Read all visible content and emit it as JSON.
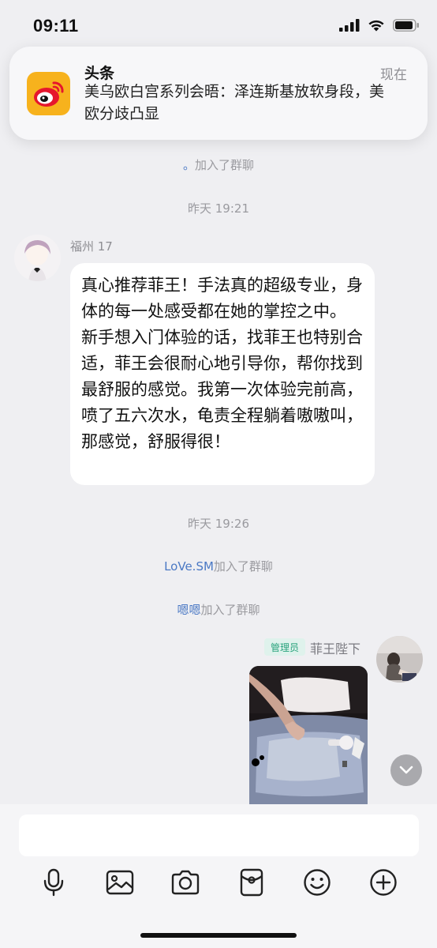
{
  "status_bar": {
    "time": "09:11"
  },
  "notification": {
    "app_icon": "weibo-icon",
    "title": "头条",
    "body": "美乌欧白宫系列会晤：泽连斯基放软身段，美欧分歧凸显",
    "time": "现在"
  },
  "chat": {
    "join_note_1": {
      "name": "。",
      "suffix": "加入了群聊"
    },
    "timestamp_1": "昨天 19:21",
    "message_1": {
      "sender": "福州 17",
      "text": "真心推荐菲王！手法真的超级专业，身体的每一处感受都在她的掌控之中。 新手想入门体验的话，找菲王也特别合适，菲王会很耐心地引导你，帮你找到最舒服的感觉。我第一次体验完前高，喷了五六次水，龟责全程躺着嗷嗷叫，那感觉，舒服得很！"
    },
    "timestamp_2": "昨天 19:26",
    "join_note_2": {
      "name": "LoVe.SM",
      "suffix": "加入了群聊"
    },
    "join_note_3": {
      "name": "嗯嗯",
      "suffix": "加入了群聊"
    },
    "message_2": {
      "role_badge": "管理员",
      "sender": "菲王陛下"
    }
  },
  "composer": {
    "placeholder": "",
    "icons": [
      "microphone-icon",
      "image-icon",
      "camera-icon",
      "red-packet-icon",
      "emoji-icon",
      "plus-icon"
    ]
  },
  "colors": {
    "background": "#efeff2",
    "link": "#4a78c4",
    "admin_badge": "#2aa37d"
  }
}
